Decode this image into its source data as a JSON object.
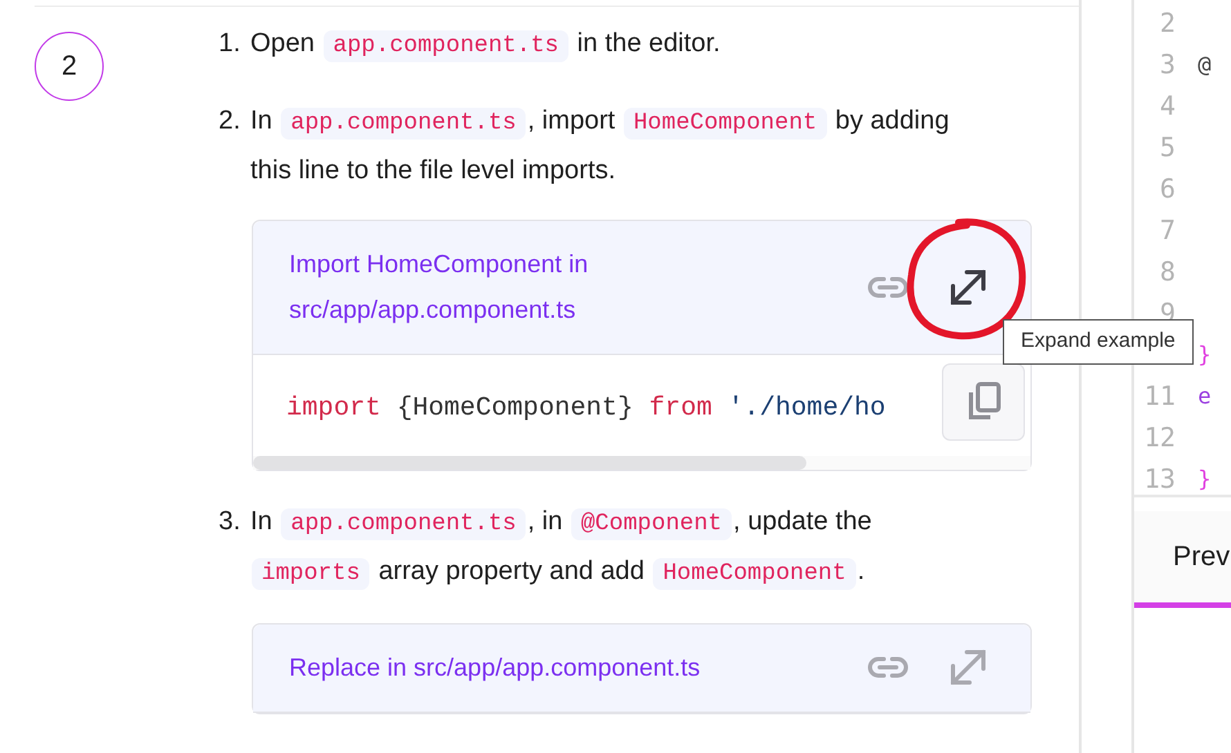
{
  "step": {
    "number": "2"
  },
  "instructions": [
    {
      "number": "1.",
      "parts": [
        {
          "kind": "text",
          "text": "Open "
        },
        {
          "kind": "code",
          "text": "app.component.ts"
        },
        {
          "kind": "text",
          "text": " in the editor."
        }
      ]
    },
    {
      "number": "2.",
      "parts": [
        {
          "kind": "text",
          "text": "In "
        },
        {
          "kind": "code",
          "text": "app.component.ts"
        },
        {
          "kind": "text",
          "text": ", import "
        },
        {
          "kind": "code",
          "text": "HomeComponent"
        },
        {
          "kind": "text",
          "text": " by adding this line to the file level imports."
        }
      ],
      "example": {
        "title": "Import HomeComponent in src/app/app.component.ts",
        "expand_highlighted": true,
        "code": [
          {
            "kind": "keyword",
            "text": "import"
          },
          {
            "kind": "plain",
            "text": " {HomeComponent} "
          },
          {
            "kind": "keyword",
            "text": "from"
          },
          {
            "kind": "string",
            "text": " './home/ho"
          }
        ],
        "tooltip": "Expand example"
      }
    },
    {
      "number": "3.",
      "parts": [
        {
          "kind": "text",
          "text": "In "
        },
        {
          "kind": "code",
          "text": "app.component.ts"
        },
        {
          "kind": "text",
          "text": ", in "
        },
        {
          "kind": "code",
          "text": "@Component"
        },
        {
          "kind": "text",
          "text": ", update the "
        },
        {
          "kind": "code",
          "text": "imports"
        },
        {
          "kind": "text",
          "text": " array property and add "
        },
        {
          "kind": "code",
          "text": "HomeComponent"
        },
        {
          "kind": "text",
          "text": "."
        }
      ],
      "example": {
        "title": "Replace in src/app/app.component.ts",
        "expand_highlighted": false
      }
    }
  ],
  "editor": {
    "lines": [
      {
        "number": "2"
      },
      {
        "number": "3",
        "code": [
          {
            "kind": "decorator",
            "text": "@"
          }
        ]
      },
      {
        "number": "4"
      },
      {
        "number": "5"
      },
      {
        "number": "6"
      },
      {
        "number": "7"
      },
      {
        "number": "8"
      },
      {
        "number": "9"
      },
      {
        "number": "11",
        "code": [
          {
            "kind": "keyword",
            "text": "e"
          }
        ]
      },
      {
        "number": "12"
      },
      {
        "number": "13",
        "code": [
          {
            "kind": "brace",
            "text": "}"
          }
        ]
      }
    ],
    "line_10_code": [
      {
        "kind": "brace",
        "text": "}"
      }
    ]
  },
  "tabs": [
    {
      "label": "Prev",
      "selected": true
    }
  ]
}
